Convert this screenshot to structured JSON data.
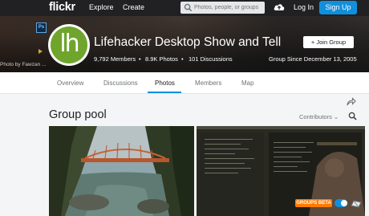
{
  "nav": {
    "logo": "flickr",
    "explore": "Explore",
    "create": "Create",
    "search_placeholder": "Photos, people, or groups",
    "login": "Log In",
    "signup": "Sign Up"
  },
  "banner": {
    "photo_credit": "Photo by Fawzan ...",
    "avatar_text": "lh",
    "title": "Lifehacker Desktop Show and Tell",
    "members": "9,792 Members",
    "photos": "8.9K Photos",
    "discussions": "101 Discussions",
    "join": "+ Join Group",
    "since": "Group Since December 13, 2005",
    "ps_icon": "Ps"
  },
  "tabs": [
    {
      "label": "Overview"
    },
    {
      "label": "Discussions"
    },
    {
      "label": "Photos"
    },
    {
      "label": "Members"
    },
    {
      "label": "Map"
    }
  ],
  "active_tab": "Photos",
  "pool": {
    "title": "Group pool",
    "contributors": "Contributors ⌄"
  },
  "beta": {
    "label": "GROUPS BETA"
  },
  "colors": {
    "topnav": "#212124",
    "accent": "#128fdc",
    "avatar_green": "#6fa52c",
    "beta_orange": "#ff7a00"
  },
  "icons": [
    "search-icon",
    "upload-cloud-icon",
    "share-icon",
    "search-pool-icon",
    "chevron-down-icon",
    "photoshop-icon",
    "arrow-icon",
    "beta-feedback-icon"
  ]
}
